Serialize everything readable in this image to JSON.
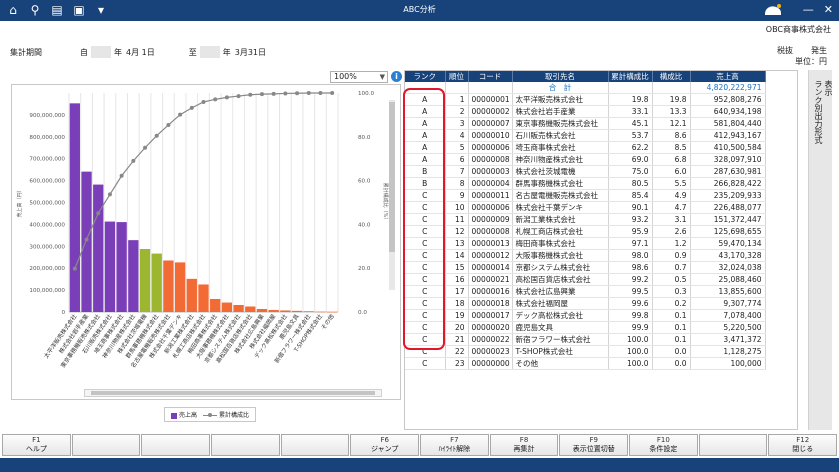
{
  "window": {
    "title": "ABC分析",
    "company": "OBC商事株式会社"
  },
  "period": {
    "label": "集計期間",
    "from_prefix": "自",
    "from_year_suffix": "年",
    "from_date": "4月 1日",
    "to_prefix": "至",
    "to_year_suffix": "年",
    "to_date": "3月31日"
  },
  "topright": {
    "tax": "税抜",
    "basis": "発生",
    "unit": "単位：円"
  },
  "zoom": {
    "value": "100%"
  },
  "table": {
    "headers": [
      "ランク",
      "順位",
      "コード",
      "取引先名",
      "累計構成比",
      "構成比",
      "売上高"
    ],
    "total": {
      "label": "合　計",
      "sales": "4,820,222,971"
    },
    "rows": [
      [
        "A",
        "1",
        "00000001",
        "太平洋販売株式会社",
        "19.8",
        "19.8",
        "952,808,276"
      ],
      [
        "A",
        "2",
        "00000002",
        "株式会社岩手産業",
        "33.1",
        "13.3",
        "640,934,198"
      ],
      [
        "A",
        "3",
        "00000007",
        "東京事務機販売株式会社",
        "45.1",
        "12.1",
        "581,804,440"
      ],
      [
        "A",
        "4",
        "00000010",
        "石川販売株式会社",
        "53.7",
        "8.6",
        "412,943,167"
      ],
      [
        "A",
        "5",
        "00000006",
        "埼玉商事株式会社",
        "62.2",
        "8.5",
        "410,500,584"
      ],
      [
        "A",
        "6",
        "00000008",
        "神奈川物産株式会社",
        "69.0",
        "6.8",
        "328,097,910"
      ],
      [
        "B",
        "7",
        "00000003",
        "株式会社茨城電機",
        "75.0",
        "6.0",
        "287,630,981"
      ],
      [
        "B",
        "8",
        "00000004",
        "群馬事務機株式会社",
        "80.5",
        "5.5",
        "266,828,422"
      ],
      [
        "C",
        "9",
        "00000011",
        "名古屋電機販売株式会社",
        "85.4",
        "4.9",
        "235,209,933"
      ],
      [
        "C",
        "10",
        "00000006",
        "株式会社千葉デンキ",
        "90.1",
        "4.7",
        "226,488,077"
      ],
      [
        "C",
        "11",
        "00000009",
        "新潟工業株式会社",
        "93.2",
        "3.1",
        "151,372,447"
      ],
      [
        "C",
        "12",
        "00000008",
        "札幌工商店株式会社",
        "95.9",
        "2.6",
        "125,698,655"
      ],
      [
        "C",
        "13",
        "00000013",
        "梅田商事株式会社",
        "97.1",
        "1.2",
        "59,470,134"
      ],
      [
        "C",
        "14",
        "00000012",
        "大阪事務機株式会社",
        "98.0",
        "0.9",
        "43,170,328"
      ],
      [
        "C",
        "15",
        "00000014",
        "京都システム株式会社",
        "98.6",
        "0.7",
        "32,024,038"
      ],
      [
        "C",
        "16",
        "00000021",
        "高松国百貨店株式会社",
        "99.2",
        "0.5",
        "25,088,460"
      ],
      [
        "C",
        "17",
        "00000016",
        "株式会社広島興業",
        "99.5",
        "0.3",
        "13,855,600"
      ],
      [
        "C",
        "18",
        "00000018",
        "株式会社福岡屋",
        "99.6",
        "0.2",
        "9,307,774"
      ],
      [
        "C",
        "19",
        "00000017",
        "デック高松株式会社",
        "99.8",
        "0.1",
        "7,078,400"
      ],
      [
        "C",
        "20",
        "00000020",
        "鹿児島文具",
        "99.9",
        "0.1",
        "5,220,500"
      ],
      [
        "C",
        "21",
        "00000022",
        "新宿フラワー株式会社",
        "100.0",
        "0.1",
        "3,471,372"
      ],
      [
        "C",
        "22",
        "00000023",
        "T-SHOP株式会社",
        "100.0",
        "0.0",
        "1,128,275"
      ],
      [
        "C",
        "23",
        "00000000",
        "その他",
        "100.0",
        "0.0",
        "100,000"
      ]
    ]
  },
  "chart_data": {
    "type": "bar",
    "ylabel": "売上高（円）",
    "y2label": "累計構成比（%）",
    "ylim": [
      0,
      1000000000
    ],
    "y2lim": [
      0,
      100
    ],
    "y_ticks": [
      "0",
      "100,000,000",
      "200,000,000",
      "300,000,000",
      "400,000,000",
      "500,000,000",
      "600,000,000",
      "700,000,000",
      "800,000,000",
      "900,000,000"
    ],
    "y2_ticks": [
      "0.0",
      "20.0",
      "40.0",
      "60.0",
      "80.0",
      "100.0"
    ],
    "categories": [
      "太平洋販売株式会社",
      "株式会社岩手産業",
      "東京事務機販売株式会社",
      "石川販売株式会社",
      "埼玉商事株式会社",
      "神奈川物産株式会社",
      "株式会社茨城電機",
      "群馬事務機株式会社",
      "名古屋電機販売株式会社",
      "株式会社千葉デンキ",
      "新潟工業株式会社",
      "札幌工商店株式会社",
      "梅田商事株式会社",
      "大阪事務機株式会社",
      "京都システム株式会社",
      "高松国百貨店株式会社",
      "株式会社広島興業",
      "株式会社福岡屋",
      "デック高松株式会社",
      "鹿児島文具",
      "新宿フラワー株式会社",
      "T-SHOP株式会社",
      "その他"
    ],
    "series": [
      {
        "name": "売上高",
        "type": "bar",
        "values": [
          952808276,
          640934198,
          581804440,
          412943167,
          410500584,
          328097910,
          287630981,
          266828422,
          235209933,
          226488077,
          151372447,
          125698655,
          59470134,
          43170328,
          32024038,
          25088460,
          13855600,
          9307774,
          7078400,
          5220500,
          3471372,
          1128275,
          100000
        ]
      },
      {
        "name": "累計構成比",
        "type": "line",
        "values": [
          19.8,
          33.1,
          45.1,
          53.7,
          62.2,
          69.0,
          75.0,
          80.5,
          85.4,
          90.1,
          93.2,
          95.9,
          97.1,
          98.0,
          98.6,
          99.2,
          99.5,
          99.6,
          99.8,
          99.9,
          100.0,
          100.0,
          100.0
        ]
      }
    ],
    "ranks": [
      "A",
      "A",
      "A",
      "A",
      "A",
      "A",
      "B",
      "B",
      "C",
      "C",
      "C",
      "C",
      "C",
      "C",
      "C",
      "C",
      "C",
      "C",
      "C",
      "C",
      "C",
      "C",
      "C"
    ],
    "colors": {
      "A": "#7a3fb8",
      "B": "#9cb62f",
      "C": "#f26a34",
      "line": "#888888"
    },
    "grid": true,
    "legend": "bottom-center"
  },
  "side_tab": {
    "line1": "ランク別出力形式",
    "line2": "表示"
  },
  "fkeys": [
    {
      "key": "F1",
      "label": "ヘルプ"
    },
    {
      "key": "",
      "label": ""
    },
    {
      "key": "",
      "label": ""
    },
    {
      "key": "",
      "label": ""
    },
    {
      "key": "",
      "label": ""
    },
    {
      "key": "F6",
      "label": "ジャンプ"
    },
    {
      "key": "F7",
      "label": "ﾊｲﾗｲﾄ解除"
    },
    {
      "key": "F8",
      "label": "再集計"
    },
    {
      "key": "F9",
      "label": "表示位置切替"
    },
    {
      "key": "F10",
      "label": "条件設定"
    },
    {
      "key": "",
      "label": ""
    },
    {
      "key": "F12",
      "label": "閉じる"
    }
  ]
}
